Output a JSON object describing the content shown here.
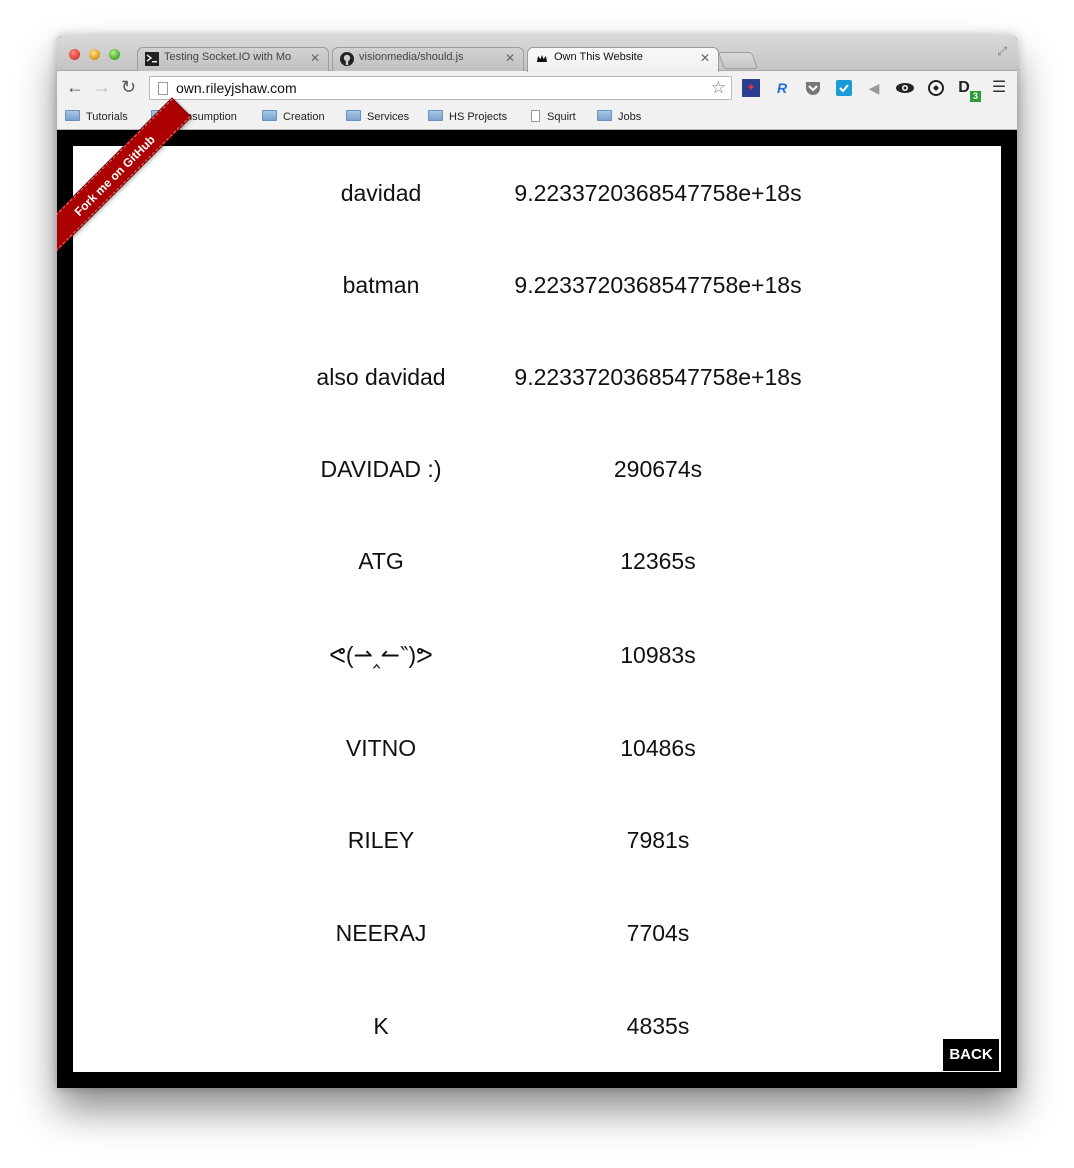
{
  "browser": {
    "tabs": [
      {
        "label": "Testing Socket.IO with Mo",
        "icon": "terminal-icon",
        "active": false
      },
      {
        "label": "visionmedia/should.js",
        "icon": "github-icon",
        "active": false
      },
      {
        "label": "Own This Website",
        "icon": "crown-icon",
        "active": true
      }
    ],
    "url": "own.rileyjshaw.com",
    "bookmarks": [
      {
        "label": "Tutorials",
        "icon": "folder-icon"
      },
      {
        "label": "Consumption",
        "icon": "folder-icon"
      },
      {
        "label": "Creation",
        "icon": "folder-icon"
      },
      {
        "label": "Services",
        "icon": "folder-icon"
      },
      {
        "label": "HS Projects",
        "icon": "folder-icon"
      },
      {
        "label": "Squirt",
        "icon": "page-icon"
      },
      {
        "label": "Jobs",
        "icon": "folder-icon"
      }
    ],
    "extension_badge": "3"
  },
  "page": {
    "ribbon_label": "Fork me on GitHub",
    "back_label": "BACK",
    "leaderboard": [
      {
        "name": "davidad",
        "time": "9.2233720368547758e+18s"
      },
      {
        "name": "batman",
        "time": "9.2233720368547758e+18s"
      },
      {
        "name": "also davidad",
        "time": "9.2233720368547758e+18s"
      },
      {
        "name": "DAVIDAD :)",
        "time": "290674s"
      },
      {
        "name": "ATG",
        "time": "12365s"
      },
      {
        "name": "ᕙ(⇀‸↼‶)ᕗ",
        "time": "10983s"
      },
      {
        "name": "VITNO",
        "time": "10486s"
      },
      {
        "name": "RILEY",
        "time": "7981s"
      },
      {
        "name": "NEERAJ",
        "time": "7704s"
      },
      {
        "name": "K",
        "time": "4835s"
      }
    ]
  }
}
